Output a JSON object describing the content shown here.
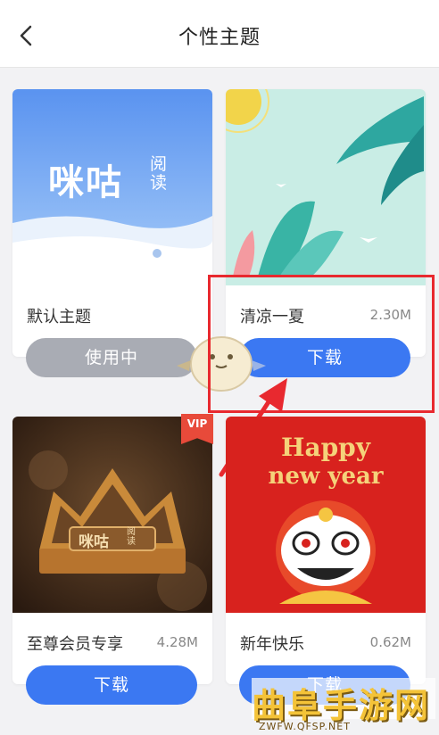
{
  "header": {
    "title": "个性主题"
  },
  "themes": [
    {
      "name": "默认主题",
      "size": "",
      "button": "使用中",
      "state": "in-use"
    },
    {
      "name": "清凉一夏",
      "size": "2.30M",
      "button": "下载",
      "state": "download"
    },
    {
      "name": "至尊会员专享",
      "size": "4.28M",
      "button": "下载",
      "state": "download",
      "badge": "VIP"
    },
    {
      "name": "新年快乐",
      "size": "0.62M",
      "button": "下载",
      "state": "download"
    }
  ],
  "previews": {
    "default_logo": "咪咕",
    "default_logo_small": "阅读",
    "vip_logo": "咪咕",
    "vip_logo_small": "阅读",
    "newyear_line1": "Happy",
    "newyear_line2": "new year"
  },
  "watermark": {
    "text": "曲阜手游网",
    "url": "ZWFW.QFSP.NET"
  },
  "colors": {
    "accent": "#3b78f2",
    "in_use": "#a9acb4",
    "highlight": "#e8292f"
  }
}
